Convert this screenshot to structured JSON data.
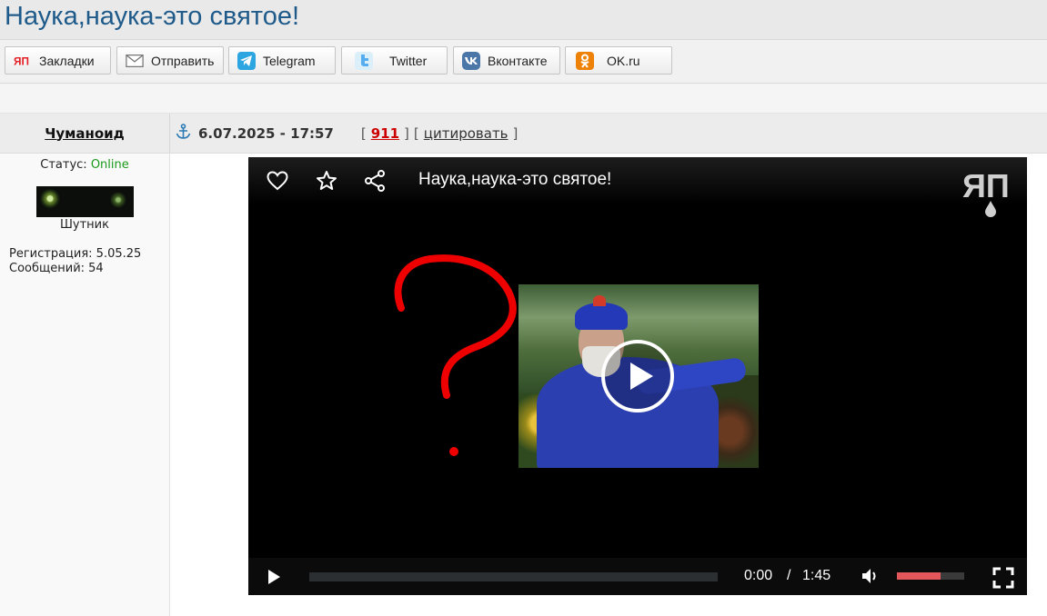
{
  "page": {
    "title": "Наука,наука-это святое!"
  },
  "share": [
    {
      "label": "Закладки",
      "icon": "yap-icon",
      "color": "#ffffff"
    },
    {
      "label": "Отправить",
      "icon": "mail-icon",
      "color": "#ffffff"
    },
    {
      "label": "Telegram",
      "icon": "telegram-icon",
      "color": "#2ca5e0"
    },
    {
      "label": "Twitter",
      "icon": "twitter-icon",
      "color": "#55acee"
    },
    {
      "label": "Вконтакте",
      "icon": "vk-icon",
      "color": "#4a76a8"
    },
    {
      "label": "OK.ru",
      "icon": "ok-icon",
      "color": "#ee8208"
    }
  ],
  "post": {
    "author": "Чуманоид",
    "date": "6.07.2025 - 17:57",
    "number": "911",
    "quote_label": "цитировать",
    "bracket_open": "[",
    "bracket_close": "]"
  },
  "user": {
    "status_label": "Статус:",
    "status_value": "Online",
    "status_color": "#1a9a1a",
    "rank": "Шутник",
    "registration": "Регистрация: 5.05.25",
    "messages": "Сообщений: 54"
  },
  "video": {
    "title": "Наука,наука-это святое!",
    "time_current": "0:00",
    "time_separator": "/",
    "duration": "1:45",
    "progress": 0.0,
    "volume": 0.65,
    "accent_color": "#e3575a",
    "annotation_color": "#ee0000"
  }
}
